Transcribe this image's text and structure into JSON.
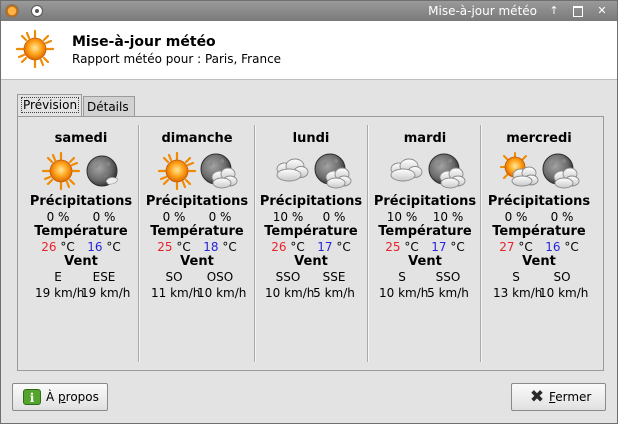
{
  "window": {
    "title": "Mise-à-jour météo",
    "buttons": {
      "shade": "↑",
      "close": "✕"
    }
  },
  "header": {
    "title": "Mise-à-jour météo",
    "subtitle": "Rapport météo pour : Paris, France"
  },
  "tabs": [
    {
      "label": "Prévision",
      "active": true
    },
    {
      "label": "Détails",
      "active": false
    }
  ],
  "labels": {
    "precipitations": "Précipitations",
    "temperature": "Température",
    "wind": "Vent"
  },
  "colors": {
    "high_temp": "#e8212b",
    "low_temp": "#2626d8"
  },
  "days": [
    {
      "name": "samedi",
      "icons": [
        "sun-icon",
        "moon-clear-icon"
      ],
      "precip": [
        "0 %",
        "0 %"
      ],
      "temp_high": "26",
      "temp_high_unit": "°C",
      "temp_low": "16",
      "temp_low_unit": "°C",
      "wind_dir": [
        "E",
        "ESE"
      ],
      "wind_speed": [
        "19 km/h",
        "19 km/h"
      ]
    },
    {
      "name": "dimanche",
      "icons": [
        "sun-icon",
        "moon-cloudy-icon"
      ],
      "precip": [
        "0 %",
        "0 %"
      ],
      "temp_high": "25",
      "temp_high_unit": "°C",
      "temp_low": "18",
      "temp_low_unit": "°C",
      "wind_dir": [
        "SO",
        "OSO"
      ],
      "wind_speed": [
        "11 km/h",
        "10 km/h"
      ]
    },
    {
      "name": "lundi",
      "icons": [
        "cloud-icon",
        "moon-cloudy-icon"
      ],
      "precip": [
        "10 %",
        "0 %"
      ],
      "temp_high": "26",
      "temp_high_unit": "°C",
      "temp_low": "17",
      "temp_low_unit": "°C",
      "wind_dir": [
        "SSO",
        "SSE"
      ],
      "wind_speed": [
        "10 km/h",
        "5 km/h"
      ]
    },
    {
      "name": "mardi",
      "icons": [
        "cloud-icon",
        "moon-cloudy-icon"
      ],
      "precip": [
        "10 %",
        "10 %"
      ],
      "temp_high": "25",
      "temp_high_unit": "°C",
      "temp_low": "17",
      "temp_low_unit": "°C",
      "wind_dir": [
        "S",
        "SSO"
      ],
      "wind_speed": [
        "10 km/h",
        "5 km/h"
      ]
    },
    {
      "name": "mercredi",
      "icons": [
        "sun-cloud-icon",
        "moon-cloudy-icon"
      ],
      "precip": [
        "0 %",
        "0 %"
      ],
      "temp_high": "27",
      "temp_high_unit": "°C",
      "temp_low": "16",
      "temp_low_unit": "°C",
      "wind_dir": [
        "S",
        "SO"
      ],
      "wind_speed": [
        "13 km/h",
        "10 km/h"
      ]
    }
  ],
  "footer": {
    "about_label_pre": "À ",
    "about_label_underline": "p",
    "about_label_post": "ropos",
    "close_label_underline": "F",
    "close_label_post": "ermer"
  }
}
